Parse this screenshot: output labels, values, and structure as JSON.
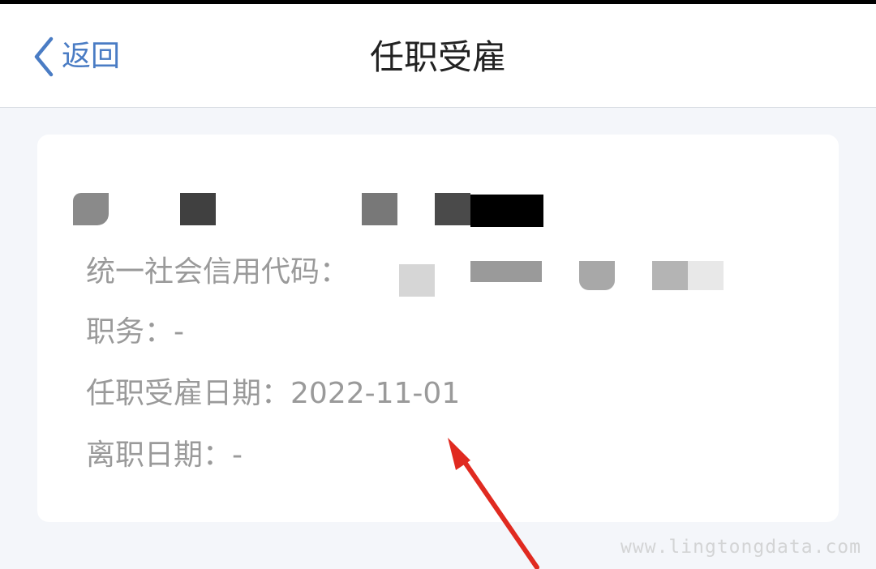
{
  "nav": {
    "back_label": "返回",
    "title": "任职受雇"
  },
  "record": {
    "credit_code_label": "统一社会信用代码：",
    "position_label": "职务：",
    "position_value": "-",
    "employment_date_label": "任职受雇日期：",
    "employment_date_value": "2022-11-01",
    "resignation_date_label": "离职日期：",
    "resignation_date_value": "-"
  },
  "watermark": "www.lingtongdata.com",
  "colors": {
    "accent": "#4a7cc4",
    "annotation_arrow": "#e02a20",
    "label_gray": "#9a9a9a",
    "page_background": "#f4f6fa"
  },
  "icons": {
    "back": "chevron-left-icon"
  }
}
